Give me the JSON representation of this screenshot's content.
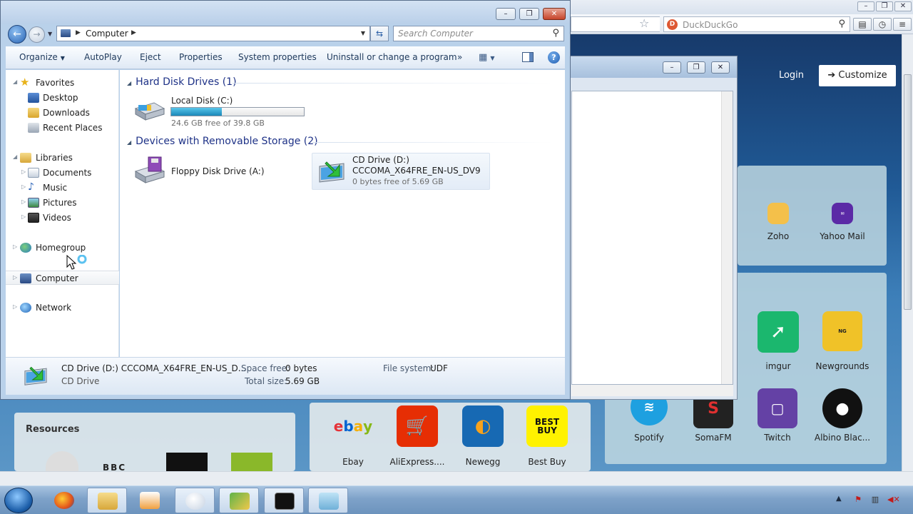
{
  "browser": {
    "search_engine": "DuckDuckGo",
    "login_label": "Login",
    "customize_label": "Customize",
    "resources_heading": "Resources",
    "tiles": [
      {
        "label": "Zoho",
        "icon": "zoho-icon",
        "color": "#f4c04a"
      },
      {
        "label": "Yahoo Mail",
        "icon": "yahoo-mail-icon",
        "color": "#5b2aa6"
      },
      {
        "label": "imgur",
        "icon": "imgur-icon",
        "color": "#1bb76e"
      },
      {
        "label": "Newgrounds",
        "icon": "newgrounds-icon",
        "color": "#2b2b2b"
      },
      {
        "label": "Spotify",
        "icon": "spotify-icon",
        "color": "#1db954"
      },
      {
        "label": "SomaFM",
        "icon": "somafm-icon",
        "color": "#cc1f1f"
      },
      {
        "label": "Twitch",
        "icon": "twitch-icon",
        "color": "#6441a5"
      },
      {
        "label": "Albino Blac...",
        "icon": "albino-blacksheep-icon",
        "color": "#111111"
      },
      {
        "label": "Ebay",
        "icon": "ebay-icon",
        "color": "#e53238"
      },
      {
        "label": "AliExpress....",
        "icon": "aliexpress-icon",
        "color": "#e62e04"
      },
      {
        "label": "Newegg",
        "icon": "newegg-icon",
        "color": "#1769b3"
      },
      {
        "label": "Best Buy",
        "icon": "best-buy-icon",
        "color": "#fff200"
      }
    ],
    "icon_glyphs": {
      "bbc": "BBC",
      "bestbuy": "BEST BUY",
      "ebay": "ebay"
    }
  },
  "explorer": {
    "address": {
      "location": "Computer"
    },
    "search": {
      "placeholder": "Search Computer"
    },
    "commands": {
      "organize": "Organize",
      "autoplay": "AutoPlay",
      "eject": "Eject",
      "properties": "Properties",
      "system_properties": "System properties",
      "uninstall": "Uninstall or change a program",
      "more": "»"
    },
    "nav": {
      "favorites": "Favorites",
      "desktop": "Desktop",
      "downloads": "Downloads",
      "recent_places": "Recent Places",
      "libraries": "Libraries",
      "documents": "Documents",
      "music": "Music",
      "pictures": "Pictures",
      "videos": "Videos",
      "homegroup": "Homegroup",
      "computer": "Computer",
      "network": "Network"
    },
    "groups": {
      "hard_disk": "Hard Disk Drives (1)",
      "removable": "Devices with Removable Storage (2)"
    },
    "drives": {
      "local_disk": {
        "name": "Local Disk (C:)",
        "free": "24.6 GB free of 39.8 GB",
        "used_fraction": 0.38
      },
      "floppy": {
        "name": "Floppy Disk Drive (A:)"
      },
      "cd": {
        "name": "CD Drive (D:)",
        "label": "CCCOMA_X64FRE_EN-US_DV9",
        "free": "0 bytes free of 5.69 GB"
      }
    },
    "details": {
      "title": "CD Drive (D:) CCCOMA_X64FRE_EN-US_D...",
      "type": "CD Drive",
      "space_free_key": "Space free:",
      "space_free_val": "0 bytes",
      "total_size_key": "Total size:",
      "total_size_val": "5.69 GB",
      "fs_key": "File system:",
      "fs_val": "UDF"
    }
  },
  "colors": {
    "accent": "#1e3287",
    "capacity": "#1a87b8",
    "close": "#c6442a"
  }
}
